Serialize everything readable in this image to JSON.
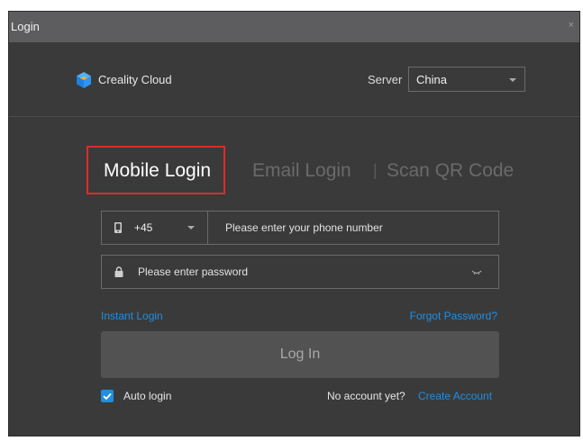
{
  "window": {
    "title": "Login",
    "close_glyph": "×"
  },
  "header": {
    "brand": "Creality Cloud",
    "server_label": "Server",
    "server_value": "China"
  },
  "tabs": {
    "mobile": "Mobile Login",
    "email": "Email Login",
    "separator": "|",
    "qr": "Scan QR Code",
    "active": "mobile"
  },
  "phone": {
    "country_code": "+45",
    "placeholder": "Please enter your phone number"
  },
  "password": {
    "placeholder": "Please enter password"
  },
  "links": {
    "instant_login": "Instant Login",
    "forgot_password": "Forgot Password?"
  },
  "login_button": "Log In",
  "auto_login": {
    "label": "Auto login",
    "checked": true
  },
  "signup": {
    "prompt": "No account yet?",
    "link": "Create Account"
  },
  "icons": {
    "logo": "creality-cube-logo-icon",
    "phone": "phone-icon",
    "lock": "lock-icon",
    "eye": "eye-closed-icon",
    "dropdown": "chevron-down-icon",
    "check": "check-icon"
  },
  "colors": {
    "accent": "#1f8fe0",
    "highlight": "#e02a2a",
    "window_bg": "#3a3a3b",
    "titlebar_bg": "#5d5d5f"
  }
}
